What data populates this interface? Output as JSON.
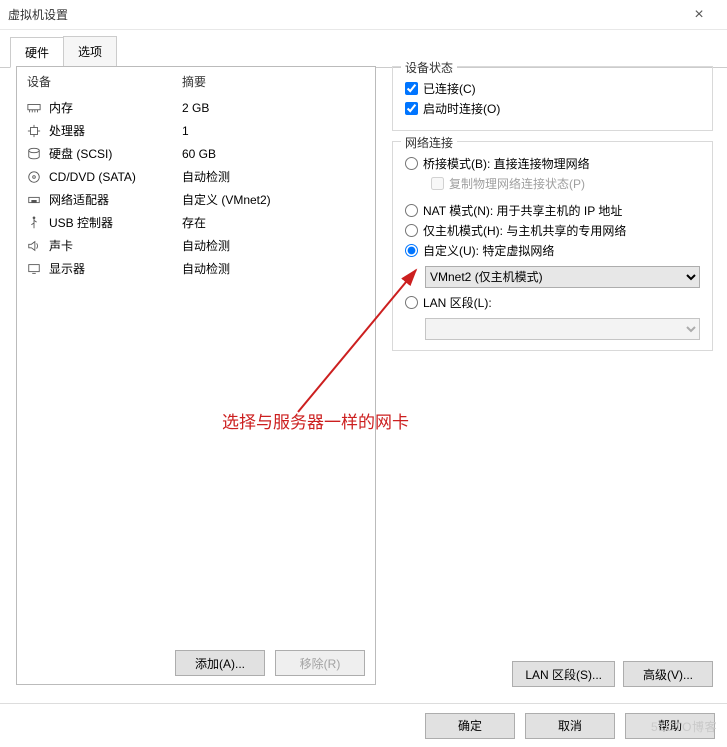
{
  "window": {
    "title": "虚拟机设置",
    "close": "×"
  },
  "tabs": {
    "hardware": "硬件",
    "options": "选项"
  },
  "hw_header": {
    "device": "设备",
    "summary": "摘要"
  },
  "hw_rows": [
    {
      "icon": "memory-icon",
      "device": "内存",
      "summary": "2 GB"
    },
    {
      "icon": "cpu-icon",
      "device": "处理器",
      "summary": "1"
    },
    {
      "icon": "disk-icon",
      "device": "硬盘 (SCSI)",
      "summary": "60 GB"
    },
    {
      "icon": "cd-icon",
      "device": "CD/DVD (SATA)",
      "summary": "自动检测"
    },
    {
      "icon": "nic-icon",
      "device": "网络适配器",
      "summary": "自定义 (VMnet2)"
    },
    {
      "icon": "usb-icon",
      "device": "USB 控制器",
      "summary": "存在"
    },
    {
      "icon": "sound-icon",
      "device": "声卡",
      "summary": "自动检测"
    },
    {
      "icon": "display-icon",
      "device": "显示器",
      "summary": "自动检测"
    }
  ],
  "left_buttons": {
    "add": "添加(A)...",
    "remove": "移除(R)"
  },
  "dev_state": {
    "title": "设备状态",
    "connected": "已连接(C)",
    "connect_at_power": "启动时连接(O)"
  },
  "net_conn": {
    "title": "网络连接",
    "bridged": "桥接模式(B): 直接连接物理网络",
    "replicate": "复制物理网络连接状态(P)",
    "nat": "NAT 模式(N): 用于共享主机的 IP 地址",
    "hostonly": "仅主机模式(H): 与主机共享的专用网络",
    "custom": "自定义(U): 特定虚拟网络",
    "custom_value": "VMnet2 (仅主机模式)",
    "lan": "LAN 区段(L):",
    "lan_value": ""
  },
  "right_buttons": {
    "lan_segments": "LAN 区段(S)...",
    "advanced": "高级(V)..."
  },
  "footer": {
    "ok": "确定",
    "cancel": "取消",
    "help": "帮助"
  },
  "annotation": "选择与服务器一样的网卡",
  "watermark": "51CTO博客"
}
